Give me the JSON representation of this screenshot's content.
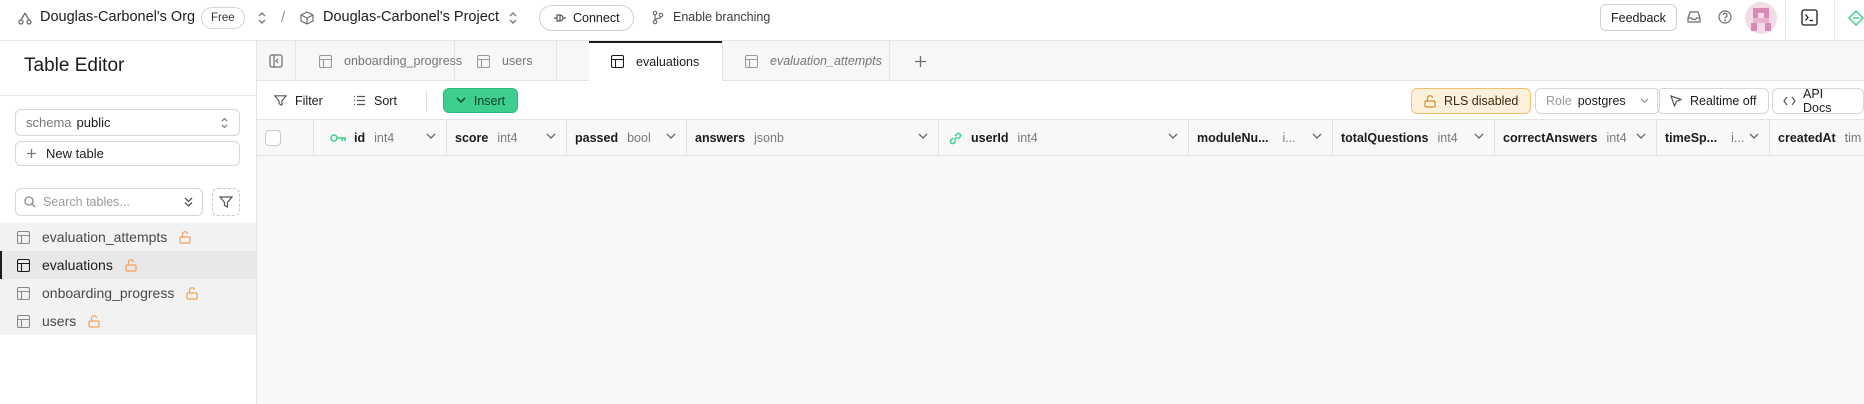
{
  "topbar": {
    "org_name": "Douglas-Carbonel's Org",
    "plan_badge": "Free",
    "separator": "/",
    "project_name": "Douglas-Carbonel's Project",
    "connect_label": "Connect",
    "branching_label": "Enable branching",
    "feedback_label": "Feedback",
    "icons": [
      "org-icon",
      "chevron-updown-icon",
      "project-box-icon",
      "plug-icon",
      "git-branch-icon",
      "inbox-icon",
      "help-icon",
      "avatar",
      "terminal-icon",
      "supabase-logo"
    ]
  },
  "sidebar": {
    "title": "Table Editor",
    "schema_prefix": "schema",
    "schema_value": "public",
    "new_table_label": "New table",
    "search_placeholder": "Search tables...",
    "tables": [
      {
        "name": "evaluation_attempts",
        "active": false
      },
      {
        "name": "evaluations",
        "active": true
      },
      {
        "name": "onboarding_progress",
        "active": false
      },
      {
        "name": "users",
        "active": false
      }
    ]
  },
  "tabs": [
    {
      "label": "onboarding_progress",
      "active": false,
      "italic": false
    },
    {
      "label": "users",
      "active": false,
      "italic": false
    },
    {
      "label": "evaluations",
      "active": true,
      "italic": false
    },
    {
      "label": "evaluation_attempts",
      "active": false,
      "italic": true
    }
  ],
  "toolbar": {
    "filter_label": "Filter",
    "sort_label": "Sort",
    "insert_label": "Insert",
    "rls_label": "RLS disabled",
    "role_prefix": "Role",
    "role_value": "postgres",
    "realtime_label": "Realtime off",
    "api_docs_label": "API Docs"
  },
  "columns": [
    {
      "name": "id",
      "type": "int4",
      "key": "primary"
    },
    {
      "name": "score",
      "type": "int4",
      "key": ""
    },
    {
      "name": "passed",
      "type": "bool",
      "key": ""
    },
    {
      "name": "answers",
      "type": "jsonb",
      "key": ""
    },
    {
      "name": "userId",
      "type": "int4",
      "key": "foreign"
    },
    {
      "name": "moduleNu...",
      "type": "i...",
      "key": ""
    },
    {
      "name": "totalQuestions",
      "type": "int4",
      "key": ""
    },
    {
      "name": "correctAnswers",
      "type": "int4",
      "key": ""
    },
    {
      "name": "timeSp...",
      "type": "i...",
      "key": ""
    },
    {
      "name": "createdAt",
      "type": "tim",
      "key": ""
    }
  ],
  "colors": {
    "insert_green": "#3ecf8e",
    "rls_warning_bg": "#fdf1dc",
    "lock_orange": "#f2a35a",
    "key_green": "#3ecf8e"
  }
}
